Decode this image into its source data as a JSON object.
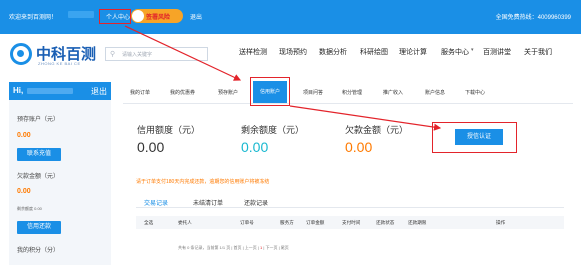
{
  "topbar": {
    "welcome": "欢迎来到百测网！",
    "personal_center": "个人中心",
    "vip_label": "签署风险",
    "logout": "退出",
    "hotline": "全国免费热线：4009960399"
  },
  "header": {
    "logo_text": "中科百测",
    "logo_sub": "ZHONG KE BAI CE",
    "search_placeholder": "请输入关键字",
    "nav": [
      "送样检测",
      "现场预约",
      "数据分析",
      "科研绘图",
      "理论计算",
      "服务中心",
      "百测讲堂",
      "关于我们"
    ]
  },
  "sidebar": {
    "greeting": "Hi,",
    "logout": "退出",
    "prepaid_label": "预存账户（元）",
    "prepaid_value": "0.00",
    "recharge_btn": "联系充值",
    "arrears_label": "欠款金额（元）",
    "arrears_value": "0.00",
    "limit_small": "剩余额度 0.00",
    "pay_btn": "信用还款",
    "points_label": "我的积分（分）"
  },
  "tabs": [
    "我的订单",
    "我的优惠券",
    "预存账户",
    "信用账户",
    "项目问答",
    "积分管理",
    "推广收入",
    "账户信息",
    "下载中心"
  ],
  "active_tab_index": 3,
  "metrics": [
    {
      "label": "信用额度（元）",
      "value": "0.00",
      "color": "#333333"
    },
    {
      "label": "剩余额度（元）",
      "value": "0.00",
      "color": "#18b8d0"
    },
    {
      "label": "欠款金额（元）",
      "value": "0.00",
      "color": "#ff7a00"
    }
  ],
  "auth_button": "授信认证",
  "notice": "请于订单支付180天内完成还款，逾期您的信用账户将被冻结",
  "subtabs": [
    "交易记录",
    "未结清订单",
    "还款记录"
  ],
  "table": {
    "headers": [
      "全选",
      "委托人",
      "订单号",
      "服务方",
      "订单金额",
      "支付时间",
      "还款状态",
      "还款期限",
      "操作"
    ]
  },
  "pager": {
    "summary": "共有 0 条记录，当前第 1/1 页",
    "first": "首页",
    "prev": "上一页",
    "current": "1",
    "next": "下一页",
    "last": "尾页"
  },
  "colors": {
    "primary": "#1a8fe6",
    "accent_orange": "#ff7a00",
    "highlight_red": "#e3242b",
    "cyan": "#18b8d0"
  }
}
